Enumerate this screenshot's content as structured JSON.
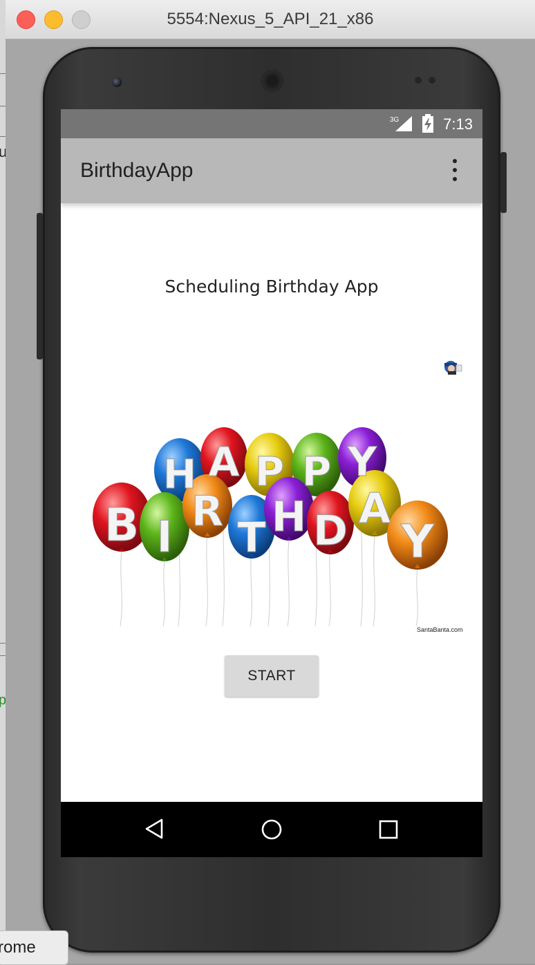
{
  "window": {
    "title": "5554:Nexus_5_API_21_x86"
  },
  "background": {
    "left_fragment_1": "u",
    "left_fragment_2": "p",
    "dock_tooltip": "rome"
  },
  "status_bar": {
    "network_type": "3G",
    "time": "7:13"
  },
  "app_bar": {
    "title": "BirthdayApp",
    "overflow_icon": "more-vert-icon"
  },
  "main": {
    "heading": "Scheduling Birthday App",
    "balloons_image": {
      "top_word": [
        "H",
        "A",
        "P",
        "P",
        "Y"
      ],
      "bottom_word": [
        "B",
        "I",
        "R",
        "T",
        "H",
        "D",
        "A",
        "Y"
      ],
      "credit": "SantaBanta.com"
    },
    "start_button": "START"
  },
  "nav_bar": {
    "back_icon": "back-triangle-icon",
    "home_icon": "home-circle-icon",
    "recents_icon": "recents-square-icon"
  },
  "colors": {
    "status_bar": "#757575",
    "app_bar": "#b8b8b8",
    "button": "#d9d9d9",
    "nav_bar": "#000000"
  }
}
